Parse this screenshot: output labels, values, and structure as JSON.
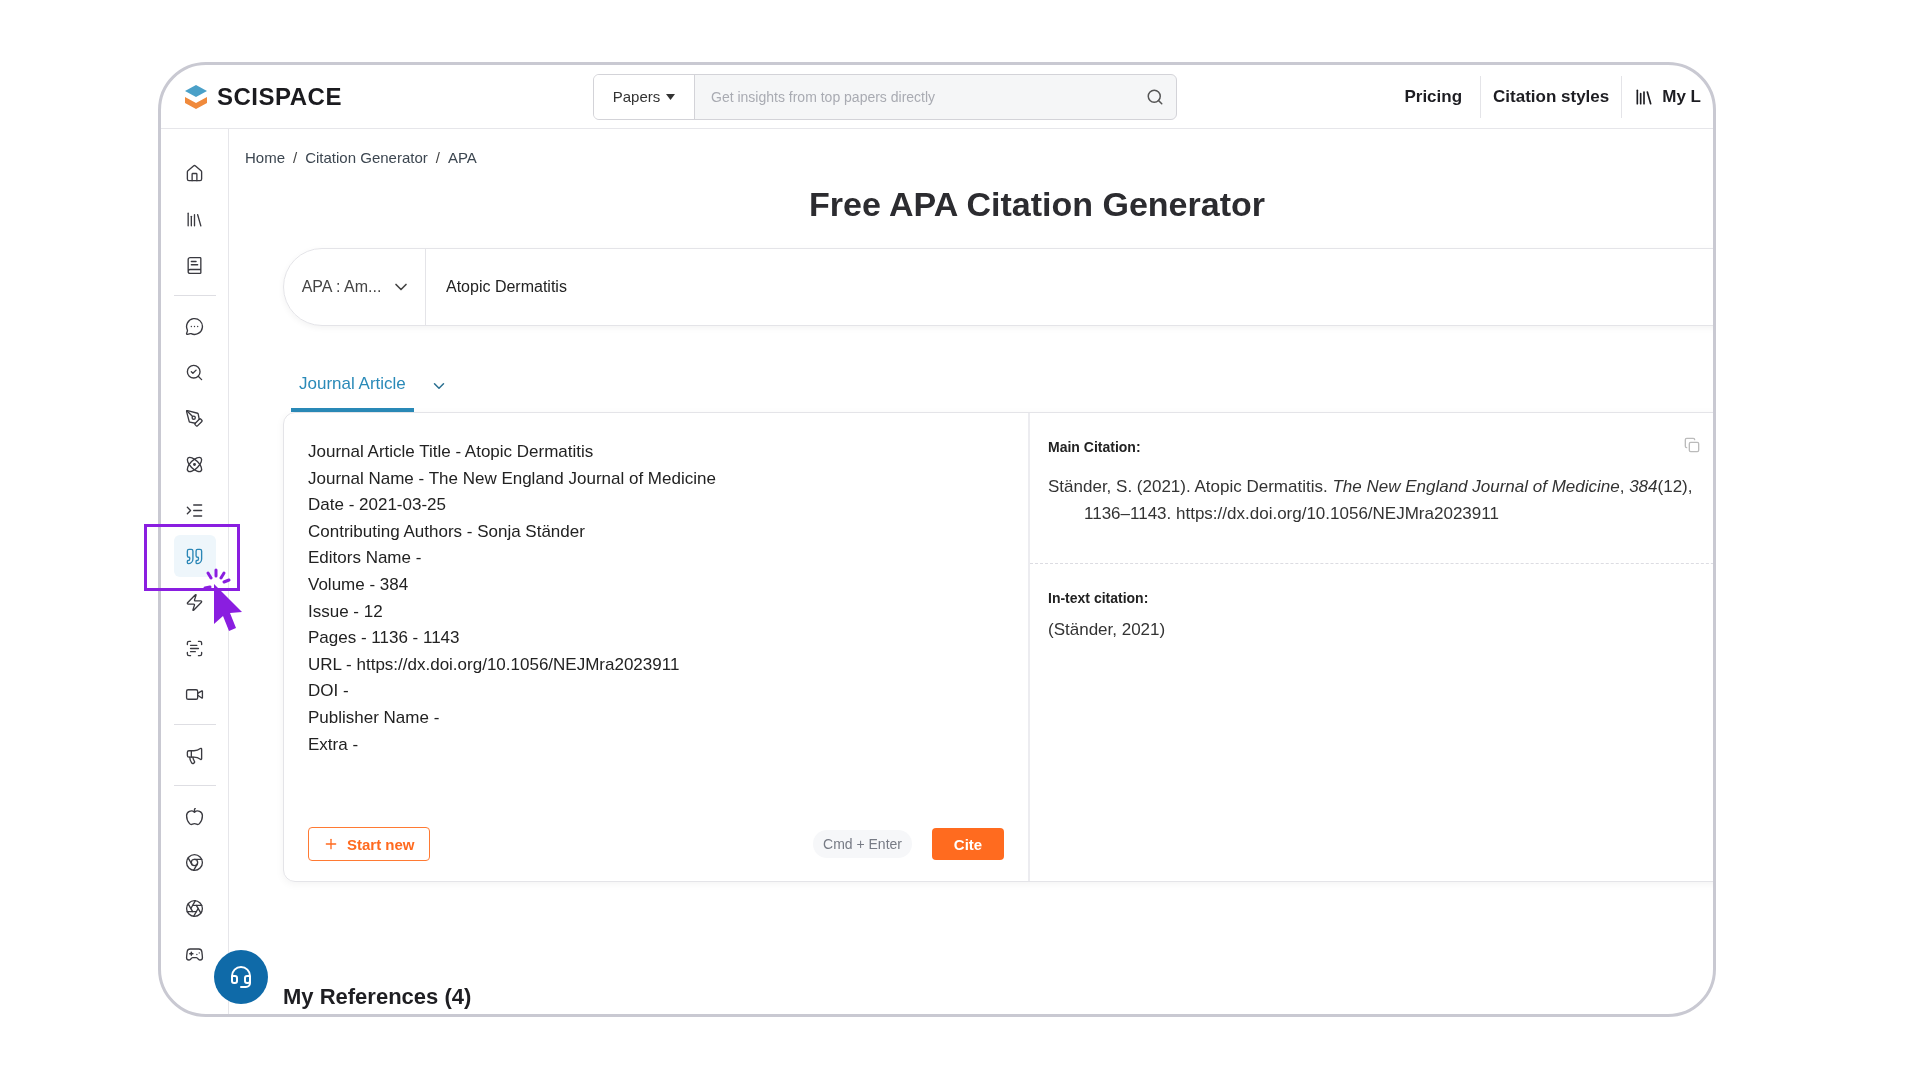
{
  "header": {
    "logo": "SCISPACE",
    "search": {
      "scope": "Papers",
      "placeholder": "Get insights from top papers directly"
    },
    "nav": [
      {
        "kind": "link",
        "label": "Pricing"
      },
      {
        "kind": "link",
        "label": "Citation styles"
      },
      {
        "kind": "library",
        "label": "My L"
      }
    ]
  },
  "sidebar": {
    "groups": [
      [
        {
          "kind": "home",
          "selected": false
        },
        {
          "kind": "library",
          "selected": false
        },
        {
          "kind": "book",
          "selected": false
        }
      ],
      [
        {
          "kind": "chat",
          "selected": false
        },
        {
          "kind": "search",
          "selected": false
        },
        {
          "kind": "pen",
          "selected": false
        },
        {
          "kind": "atom",
          "selected": false
        },
        {
          "kind": "indent",
          "selected": false
        },
        {
          "kind": "quote",
          "selected": true
        },
        {
          "kind": "zap",
          "selected": false
        },
        {
          "kind": "scan",
          "selected": false
        },
        {
          "kind": "video",
          "selected": false
        }
      ],
      [
        {
          "kind": "megaphone",
          "selected": false
        }
      ],
      [
        {
          "kind": "apple",
          "selected": false
        },
        {
          "kind": "chrome",
          "selected": false
        },
        {
          "kind": "aperture",
          "selected": false
        },
        {
          "kind": "gamepad",
          "selected": false
        }
      ]
    ]
  },
  "breadcrumb": {
    "separator": "/",
    "items": [
      "Home",
      "Citation Generator",
      "APA"
    ]
  },
  "title": "Free APA Citation Generator",
  "query": {
    "style": "APA : Am...",
    "value": "Atopic Dermatitis"
  },
  "tabs": [
    {
      "label": "Journal Article",
      "selected": true
    }
  ],
  "fields": [
    "Journal Article Title - Atopic Dermatitis",
    "Journal Name - The New England Journal of Medicine",
    "Date - 2021-03-25",
    "Contributing Authors - Sonja Ständer",
    "Editors Name -",
    "Volume - 384",
    "Issue - 12",
    "Pages - 1136 - 1143",
    "URL - https://dx.doi.org/10.1056/NEJMra2023911",
    "DOI -",
    "Publisher Name -",
    "Extra -"
  ],
  "actions": {
    "start_new": "Start new",
    "shortcut": "Cmd + Enter",
    "cite": "Cite"
  },
  "main_citation": {
    "label": "Main Citation:",
    "text": "Ständer, S. (2021). Atopic Dermatitis. *The New England Journal of Medicine*, *384*(12), 1136–1143. https://dx.doi.org/10.1056/NEJMra2023911"
  },
  "in_text_citation": {
    "label": "In-text citation:",
    "text": "(Ständer, 2021)"
  },
  "references": {
    "title": "My References (4)"
  }
}
